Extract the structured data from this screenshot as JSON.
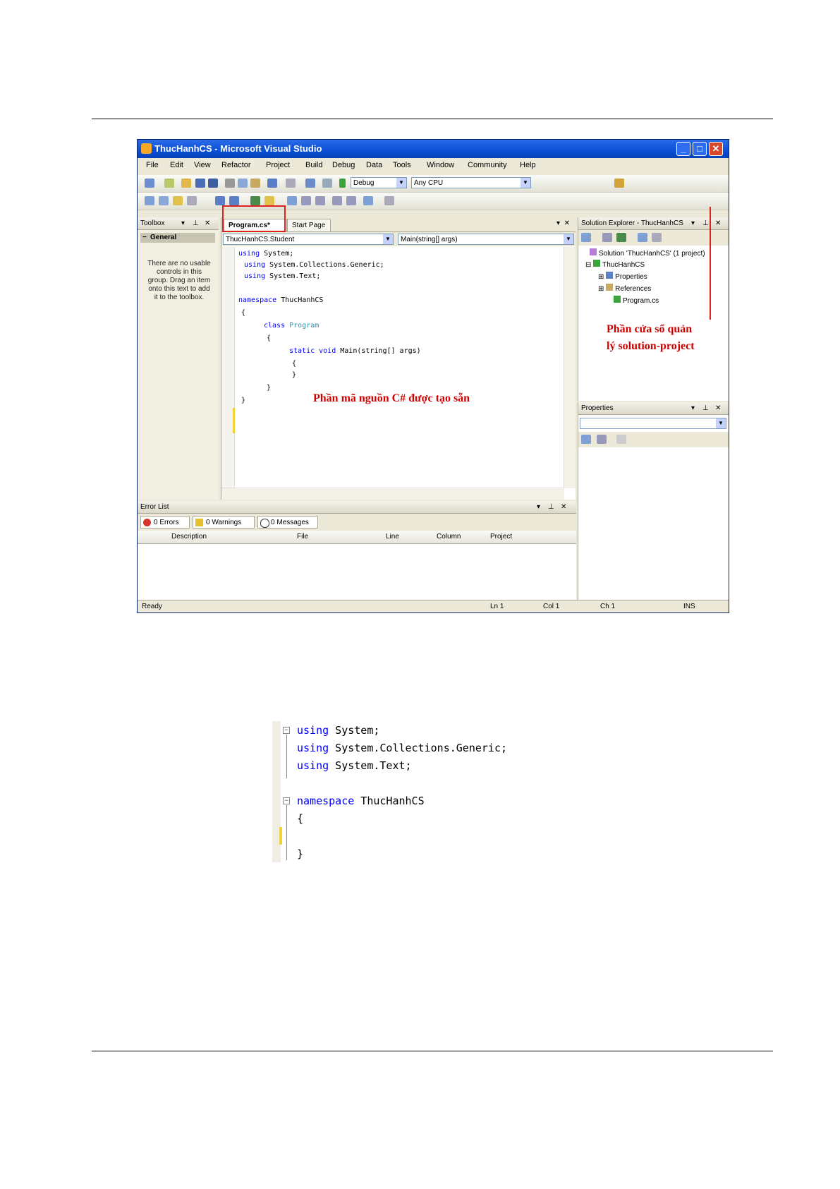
{
  "window": {
    "title": "ThucHanhCS - Microsoft Visual Studio",
    "minimize": "_",
    "maximize": "□",
    "close": "✕"
  },
  "menu": [
    "File",
    "Edit",
    "View",
    "Refactor",
    "Project",
    "Build",
    "Debug",
    "Data",
    "Tools",
    "Window",
    "Community",
    "Help"
  ],
  "toolbar": {
    "configuration": "Debug",
    "platform": "Any CPU"
  },
  "toolbox": {
    "title": "Toolbox",
    "group": "General",
    "message": "There are no usable controls in this group. Drag an item onto this text to add it to the toolbox."
  },
  "editor": {
    "tabs": [
      "Program.cs*",
      "Start Page"
    ],
    "type_combo": "ThucHanhCS.Student",
    "member_combo": "Main(string[] args)",
    "code_lines": [
      {
        "kw": "using",
        "rest": " System;"
      },
      {
        "kw": "using",
        "rest": " System.Collections.Generic;"
      },
      {
        "kw": "using",
        "rest": " System.Text;"
      },
      {
        "kw": "",
        "rest": ""
      },
      {
        "kw": "namespace",
        "rest": " ThucHanhCS"
      },
      {
        "kw": "",
        "rest": "{"
      },
      {
        "kw": "class",
        "rest": " Program"
      },
      {
        "kw": "",
        "rest": "{"
      },
      {
        "kw": "static void",
        "rest": " Main(string[] args)"
      },
      {
        "kw": "",
        "rest": "{"
      },
      {
        "kw": "",
        "rest": "}"
      },
      {
        "kw": "",
        "rest": "}"
      },
      {
        "kw": "",
        "rest": "}"
      }
    ]
  },
  "annotations": {
    "code_note": "Phần mã nguồn C# được tạo sẵn",
    "solution_note_line1": "Phần cửa sổ quản",
    "solution_note_line2": "lý solution-project"
  },
  "solution_explorer": {
    "title": "Solution Explorer - ThucHanhCS",
    "items": [
      "Solution 'ThucHanhCS' (1 project)",
      "ThucHanhCS",
      "Properties",
      "References",
      "Program.cs"
    ]
  },
  "properties": {
    "title": "Properties"
  },
  "error_list": {
    "title": "Error List",
    "tabs": [
      "0 Errors",
      "0 Warnings",
      "0 Messages"
    ],
    "columns": [
      "Description",
      "File",
      "Line",
      "Column",
      "Project"
    ]
  },
  "statusbar": {
    "state": "Ready",
    "ln": "Ln 1",
    "col": "Col 1",
    "ch": "Ch 1",
    "mode": "INS"
  },
  "snippet": {
    "lines": [
      {
        "kw": "using",
        "rest": " System;"
      },
      {
        "kw": "using",
        "rest": " System.Collections.Generic;"
      },
      {
        "kw": "using",
        "rest": " System.Text;"
      },
      {
        "kw": "",
        "rest": ""
      },
      {
        "kw": "namespace",
        "rest": " ThucHanhCS"
      },
      {
        "kw": "",
        "rest": "{"
      },
      {
        "kw": "",
        "rest": ""
      },
      {
        "kw": "",
        "rest": "}"
      }
    ]
  },
  "colors": {
    "keyword": "#0000ff",
    "annotation": "#d00000",
    "titlebar": "#0a4fd6"
  }
}
